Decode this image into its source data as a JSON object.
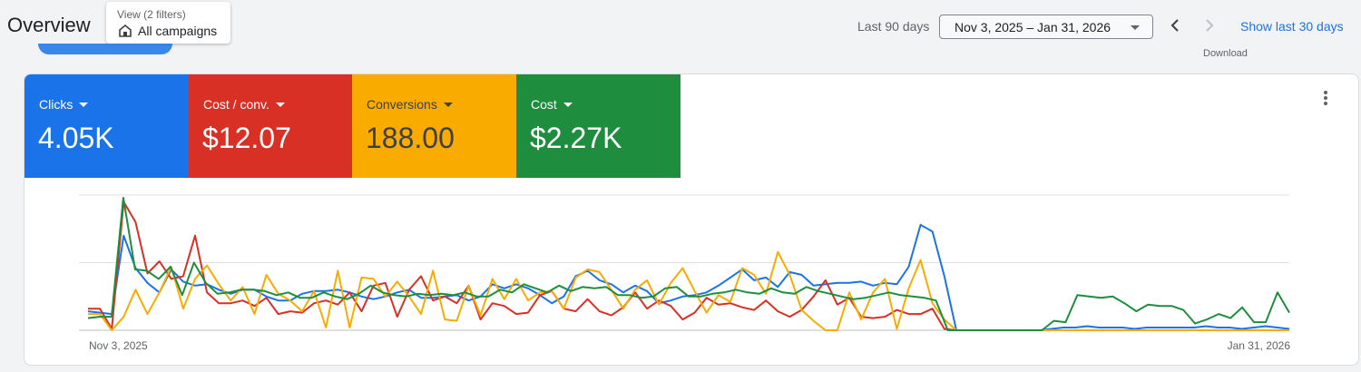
{
  "header": {
    "title": "Overview",
    "view_chip": {
      "label": "View (2 filters)",
      "value": "All campaigns"
    },
    "range_label": "Last 90 days",
    "date_range": "Nov 3, 2025 – Jan 31, 2026",
    "show_link": "Show last 30 days",
    "download_label": "Download"
  },
  "metrics": [
    {
      "label": "Clicks",
      "value": "4.05K",
      "color": "#1a73e8",
      "text_color": "#ffffff"
    },
    {
      "label": "Cost / conv.",
      "value": "$12.07",
      "color": "#d93025",
      "text_color": "#ffffff"
    },
    {
      "label": "Conversions",
      "value": "188.00",
      "color": "#f9ab00",
      "text_color": "#3c4043"
    },
    {
      "label": "Cost",
      "value": "$2.27K",
      "color": "#1e8e3e",
      "text_color": "#ffffff"
    }
  ],
  "chart_data": {
    "type": "line",
    "x_start": "Nov 3, 2025",
    "x_end": "Jan 31, 2026",
    "ylim": [
      0,
      100
    ],
    "grid": true,
    "series": [
      {
        "name": "Clicks",
        "color": "#1a73e8",
        "values": [
          14,
          13,
          12,
          70,
          46,
          35,
          28,
          45,
          36,
          33,
          34,
          30,
          27,
          30,
          30,
          25,
          22,
          22,
          27,
          29,
          29,
          30,
          28,
          25,
          23,
          25,
          28,
          30,
          24,
          24,
          25,
          26,
          22,
          25,
          34,
          31,
          34,
          31,
          26,
          20,
          25,
          40,
          44,
          37,
          34,
          28,
          33,
          29,
          20,
          22,
          25,
          26,
          28,
          33,
          39,
          45,
          37,
          39,
          32,
          43,
          41,
          33,
          34,
          35,
          35,
          36,
          33,
          35,
          34,
          47,
          78,
          73,
          40,
          0,
          0,
          0,
          0,
          0,
          0,
          0,
          0,
          1,
          2,
          2,
          3,
          2,
          2,
          2,
          1,
          2,
          2,
          2,
          2,
          2,
          3,
          2,
          2,
          1,
          2,
          3,
          2,
          1
        ]
      },
      {
        "name": "Cost / conv.",
        "color": "#d93025",
        "values": [
          16,
          16,
          1,
          95,
          80,
          42,
          51,
          38,
          40,
          70,
          28,
          20,
          20,
          22,
          18,
          24,
          12,
          14,
          13,
          20,
          22,
          19,
          28,
          14,
          33,
          35,
          10,
          30,
          40,
          22,
          25,
          20,
          33,
          8,
          20,
          18,
          12,
          13,
          26,
          29,
          16,
          14,
          23,
          14,
          11,
          17,
          28,
          16,
          22,
          18,
          8,
          13,
          24,
          19,
          20,
          17,
          15,
          22,
          14,
          10,
          15,
          25,
          37,
          19,
          24,
          10,
          9,
          10,
          15,
          12,
          12,
          16,
          1,
          0,
          0,
          0,
          0,
          0,
          0,
          0,
          0,
          0,
          0,
          0,
          0,
          0,
          0,
          0,
          0,
          0,
          0,
          0,
          0,
          0,
          0,
          0,
          0,
          0,
          0,
          0,
          0,
          0
        ]
      },
      {
        "name": "Conversions",
        "color": "#f9ab00",
        "values": [
          12,
          12,
          0,
          10,
          30,
          12,
          28,
          47,
          16,
          38,
          48,
          34,
          22,
          32,
          12,
          41,
          27,
          22,
          14,
          29,
          2,
          44,
          2,
          39,
          38,
          25,
          36,
          25,
          12,
          44,
          8,
          7,
          33,
          11,
          38,
          23,
          38,
          22,
          28,
          29,
          16,
          39,
          45,
          43,
          30,
          16,
          30,
          37,
          19,
          35,
          46,
          29,
          13,
          26,
          21,
          46,
          41,
          27,
          58,
          41,
          15,
          7,
          0,
          0,
          28,
          8,
          28,
          38,
          1,
          31,
          52,
          20,
          8,
          0,
          0,
          0,
          0,
          0,
          0,
          0,
          0,
          0,
          0,
          0,
          0,
          0,
          0,
          0,
          0,
          0,
          0,
          0,
          0,
          0,
          0,
          0,
          0,
          0,
          0,
          0,
          0,
          0
        ]
      },
      {
        "name": "Cost",
        "color": "#1e8e3e",
        "values": [
          9,
          10,
          10,
          98,
          45,
          44,
          38,
          47,
          26,
          50,
          35,
          27,
          28,
          30,
          30,
          29,
          26,
          28,
          24,
          24,
          28,
          25,
          23,
          27,
          33,
          28,
          26,
          25,
          27,
          26,
          27,
          26,
          28,
          25,
          25,
          30,
          28,
          34,
          31,
          28,
          33,
          29,
          32,
          31,
          32,
          26,
          26,
          24,
          25,
          31,
          32,
          25,
          25,
          27,
          28,
          30,
          28,
          27,
          31,
          28,
          27,
          32,
          29,
          27,
          25,
          23,
          24,
          26,
          28,
          26,
          25,
          24,
          22,
          0,
          0,
          0,
          0,
          0,
          0,
          0,
          0,
          0,
          7,
          6,
          26,
          25,
          24,
          25,
          20,
          14,
          19,
          18,
          18,
          15,
          5,
          8,
          12,
          9,
          17,
          6,
          6,
          28,
          13
        ]
      }
    ]
  }
}
